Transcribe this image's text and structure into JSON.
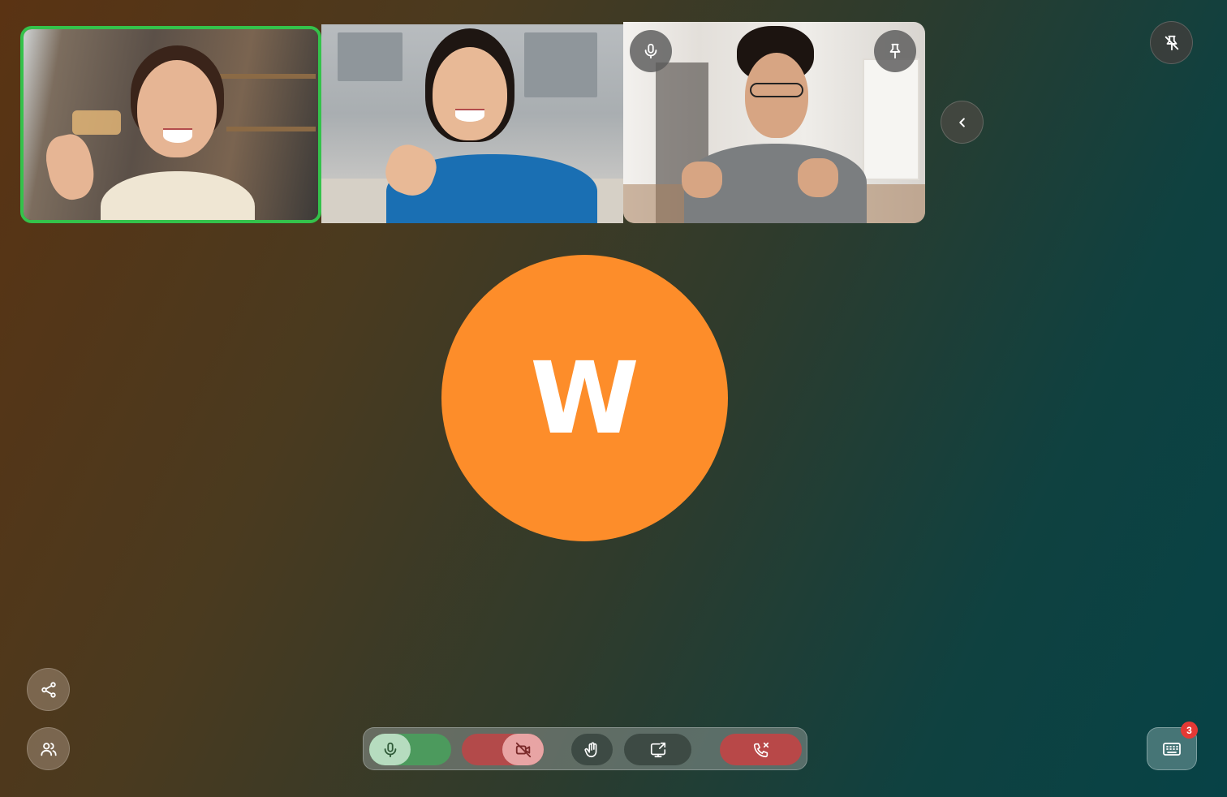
{
  "participants": [
    {
      "name": "",
      "speaking": true
    },
    {
      "name": "",
      "speaking": false
    },
    {
      "name": "",
      "speaking": false
    }
  ],
  "main_avatar": {
    "initial": "W",
    "color": "#fd8d2a"
  },
  "keyboard_badge": {
    "count": "3"
  },
  "controls": {
    "mic": {
      "state": "on",
      "color": "#4c9a5d"
    },
    "camera": {
      "state": "off",
      "color": "#b34a4a"
    },
    "end_call": {
      "color": "#b84848"
    }
  },
  "icons": [
    "mic-icon",
    "pin-icon",
    "unpin-icon",
    "chevron-left-icon",
    "share-icon",
    "people-icon",
    "camera-off-icon",
    "hand-icon",
    "screen-share-icon",
    "end-call-icon",
    "keyboard-icon"
  ],
  "colors": {
    "speaking_border": "#34c24b",
    "avatar": "#fd8d2a",
    "badge": "#e53935"
  }
}
